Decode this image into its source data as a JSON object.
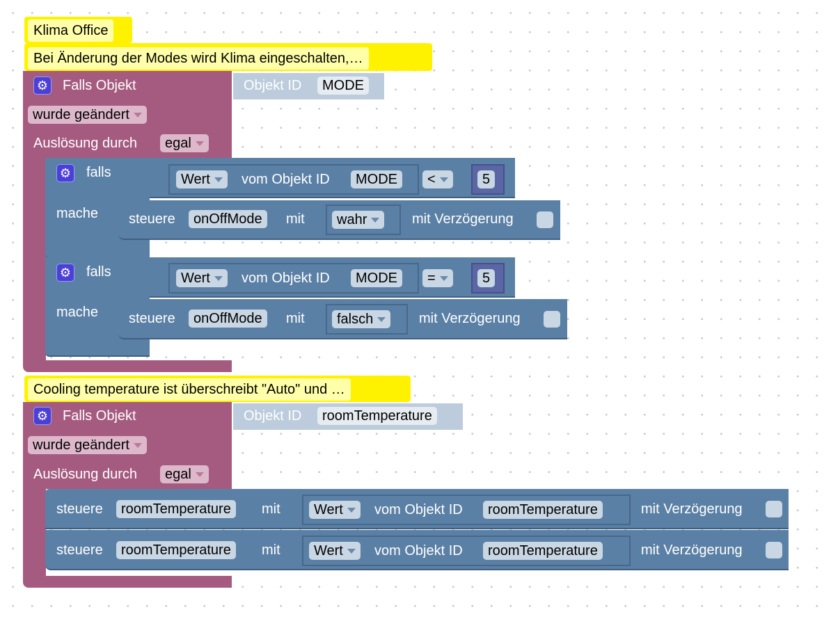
{
  "comments": [
    "Klima Office",
    "Bei Änderung der Modes wird Klima eingeschalten,…",
    "Cooling temperature ist überschreibt \"Auto\" und …"
  ],
  "colors": {
    "event_block": "#A55B80",
    "logic_block": "#5B80A5",
    "number_block": "#5B67A5",
    "comment": "#FFF200"
  },
  "trigger1": {
    "label": "Falls Objekt",
    "object_label": "Objekt ID",
    "object_id": "MODE",
    "condition": "wurde geändert",
    "source_label": "Auslösung durch",
    "source": "egal",
    "ifs": [
      {
        "falls": "falls",
        "mache": "mache",
        "value_dropdown": "Wert",
        "from_label": "vom Objekt ID",
        "object_id": "MODE",
        "operator": "<",
        "number": "5",
        "action": {
          "steuere": "steuere",
          "target": "onOffMode",
          "mit": "mit",
          "value": "wahr",
          "delay_label": "mit Verzögerung"
        }
      },
      {
        "falls": "falls",
        "mache": "mache",
        "value_dropdown": "Wert",
        "from_label": "vom Objekt ID",
        "object_id": "MODE",
        "operator": "=",
        "number": "5",
        "action": {
          "steuere": "steuere",
          "target": "onOffMode",
          "mit": "mit",
          "value": "falsch",
          "delay_label": "mit Verzögerung"
        }
      }
    ]
  },
  "trigger2": {
    "label": "Falls Objekt",
    "object_label": "Objekt ID",
    "object_id": "roomTemperature",
    "condition": "wurde geändert",
    "source_label": "Auslösung durch",
    "source": "egal",
    "actions": [
      {
        "steuere": "steuere",
        "target": "roomTemperature",
        "mit": "mit",
        "value_dropdown": "Wert",
        "from_label": "vom Objekt ID",
        "object_id": "roomTemperature",
        "delay_label": "mit Verzögerung"
      },
      {
        "steuere": "steuere",
        "target": "roomTemperature",
        "mit": "mit",
        "value_dropdown": "Wert",
        "from_label": "vom Objekt ID",
        "object_id": "roomTemperature",
        "delay_label": "mit Verzögerung"
      }
    ]
  }
}
